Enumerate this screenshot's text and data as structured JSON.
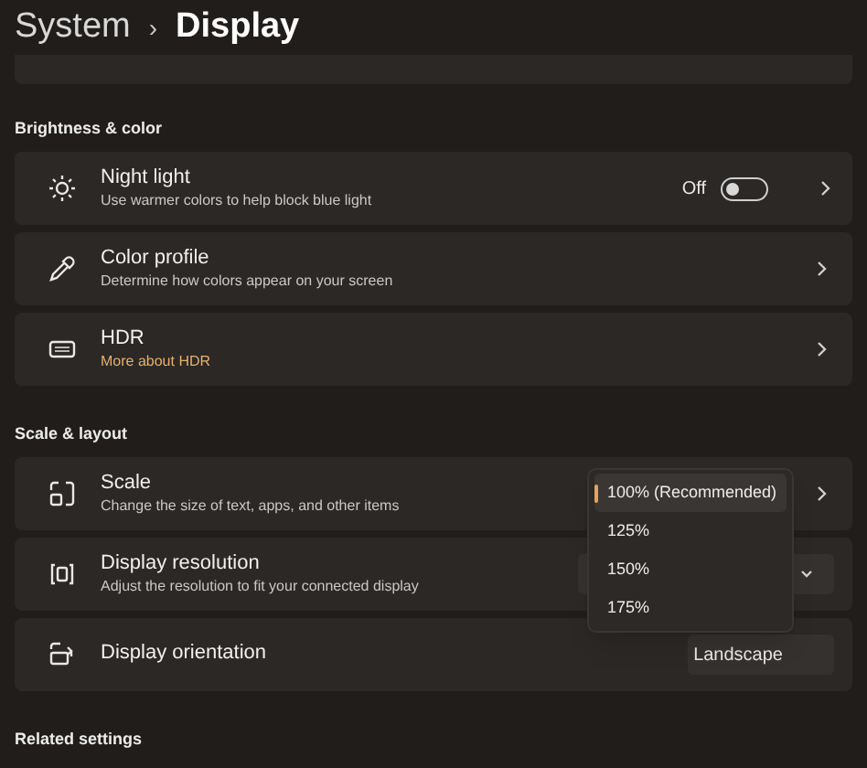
{
  "breadcrumb": {
    "parent": "System",
    "separator": "›",
    "current": "Display"
  },
  "sections": [
    {
      "heading": "Brightness & color",
      "rows": [
        {
          "kind": "toggle",
          "title": "Night light",
          "subtitle": "Use warmer colors to help block blue light",
          "state_label": "Off",
          "on": false
        },
        {
          "kind": "link",
          "title": "Color profile",
          "subtitle": "Determine how colors appear on your screen"
        },
        {
          "kind": "link",
          "title": "HDR",
          "link": "More about HDR"
        }
      ]
    },
    {
      "heading": "Scale & layout",
      "rows": [
        {
          "kind": "link",
          "title": "Scale",
          "subtitle": "Change the size of text, apps, and other items"
        },
        {
          "kind": "dropdown",
          "title": "Display resolution",
          "subtitle": "Adjust the resolution to fit your connected display"
        },
        {
          "kind": "dropdown",
          "title": "Display orientation",
          "value": "Landscape"
        }
      ]
    },
    {
      "heading": "Related settings"
    }
  ],
  "scale_menu": {
    "options": [
      {
        "label": "100% (Recommended)",
        "selected": true
      },
      {
        "label": "125%",
        "selected": false
      },
      {
        "label": "150%",
        "selected": false
      },
      {
        "label": "175%",
        "selected": false
      }
    ]
  }
}
